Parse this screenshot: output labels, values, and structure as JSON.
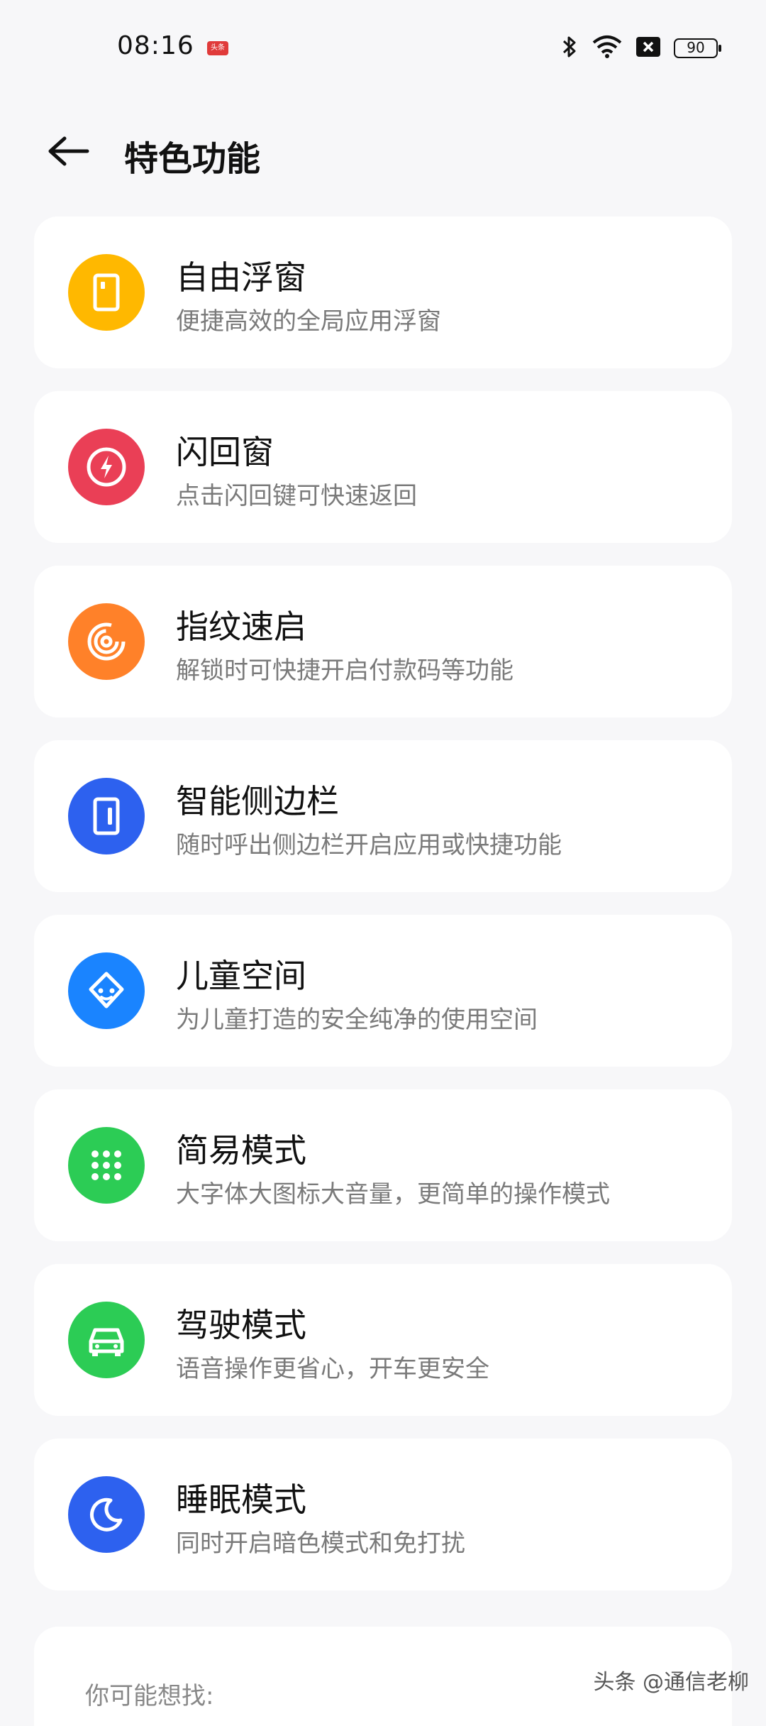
{
  "status": {
    "time": "08:16",
    "notif_badge": "头条",
    "battery": "90"
  },
  "header": {
    "title": "特色功能"
  },
  "features": [
    {
      "title": "自由浮窗",
      "subtitle": "便捷高效的全局应用浮窗",
      "icon": "floating-window-icon",
      "color": "#ffb800"
    },
    {
      "title": "闪回窗",
      "subtitle": "点击闪回键可快速返回",
      "icon": "flashback-icon",
      "color": "#ea3f56"
    },
    {
      "title": "指纹速启",
      "subtitle": "解锁时可快捷开启付款码等功能",
      "icon": "fingerprint-icon",
      "color": "#ff8129"
    },
    {
      "title": "智能侧边栏",
      "subtitle": "随时呼出侧边栏开启应用或快捷功能",
      "icon": "sidebar-icon",
      "color": "#2d61ef"
    },
    {
      "title": "儿童空间",
      "subtitle": "为儿童打造的安全纯净的使用空间",
      "icon": "child-face-icon",
      "color": "#1a84ff"
    },
    {
      "title": "简易模式",
      "subtitle": "大字体大图标大音量，更简单的操作模式",
      "icon": "grid-dots-icon",
      "color": "#2ccc55"
    },
    {
      "title": "驾驶模式",
      "subtitle": "语音操作更省心，开车更安全",
      "icon": "car-icon",
      "color": "#2ccc55"
    },
    {
      "title": "睡眠模式",
      "subtitle": "同时开启暗色模式和免打扰",
      "icon": "moon-icon",
      "color": "#2d61ef"
    }
  ],
  "suggest": {
    "label": "你可能想找:"
  },
  "watermark": "头条 @通信老柳"
}
